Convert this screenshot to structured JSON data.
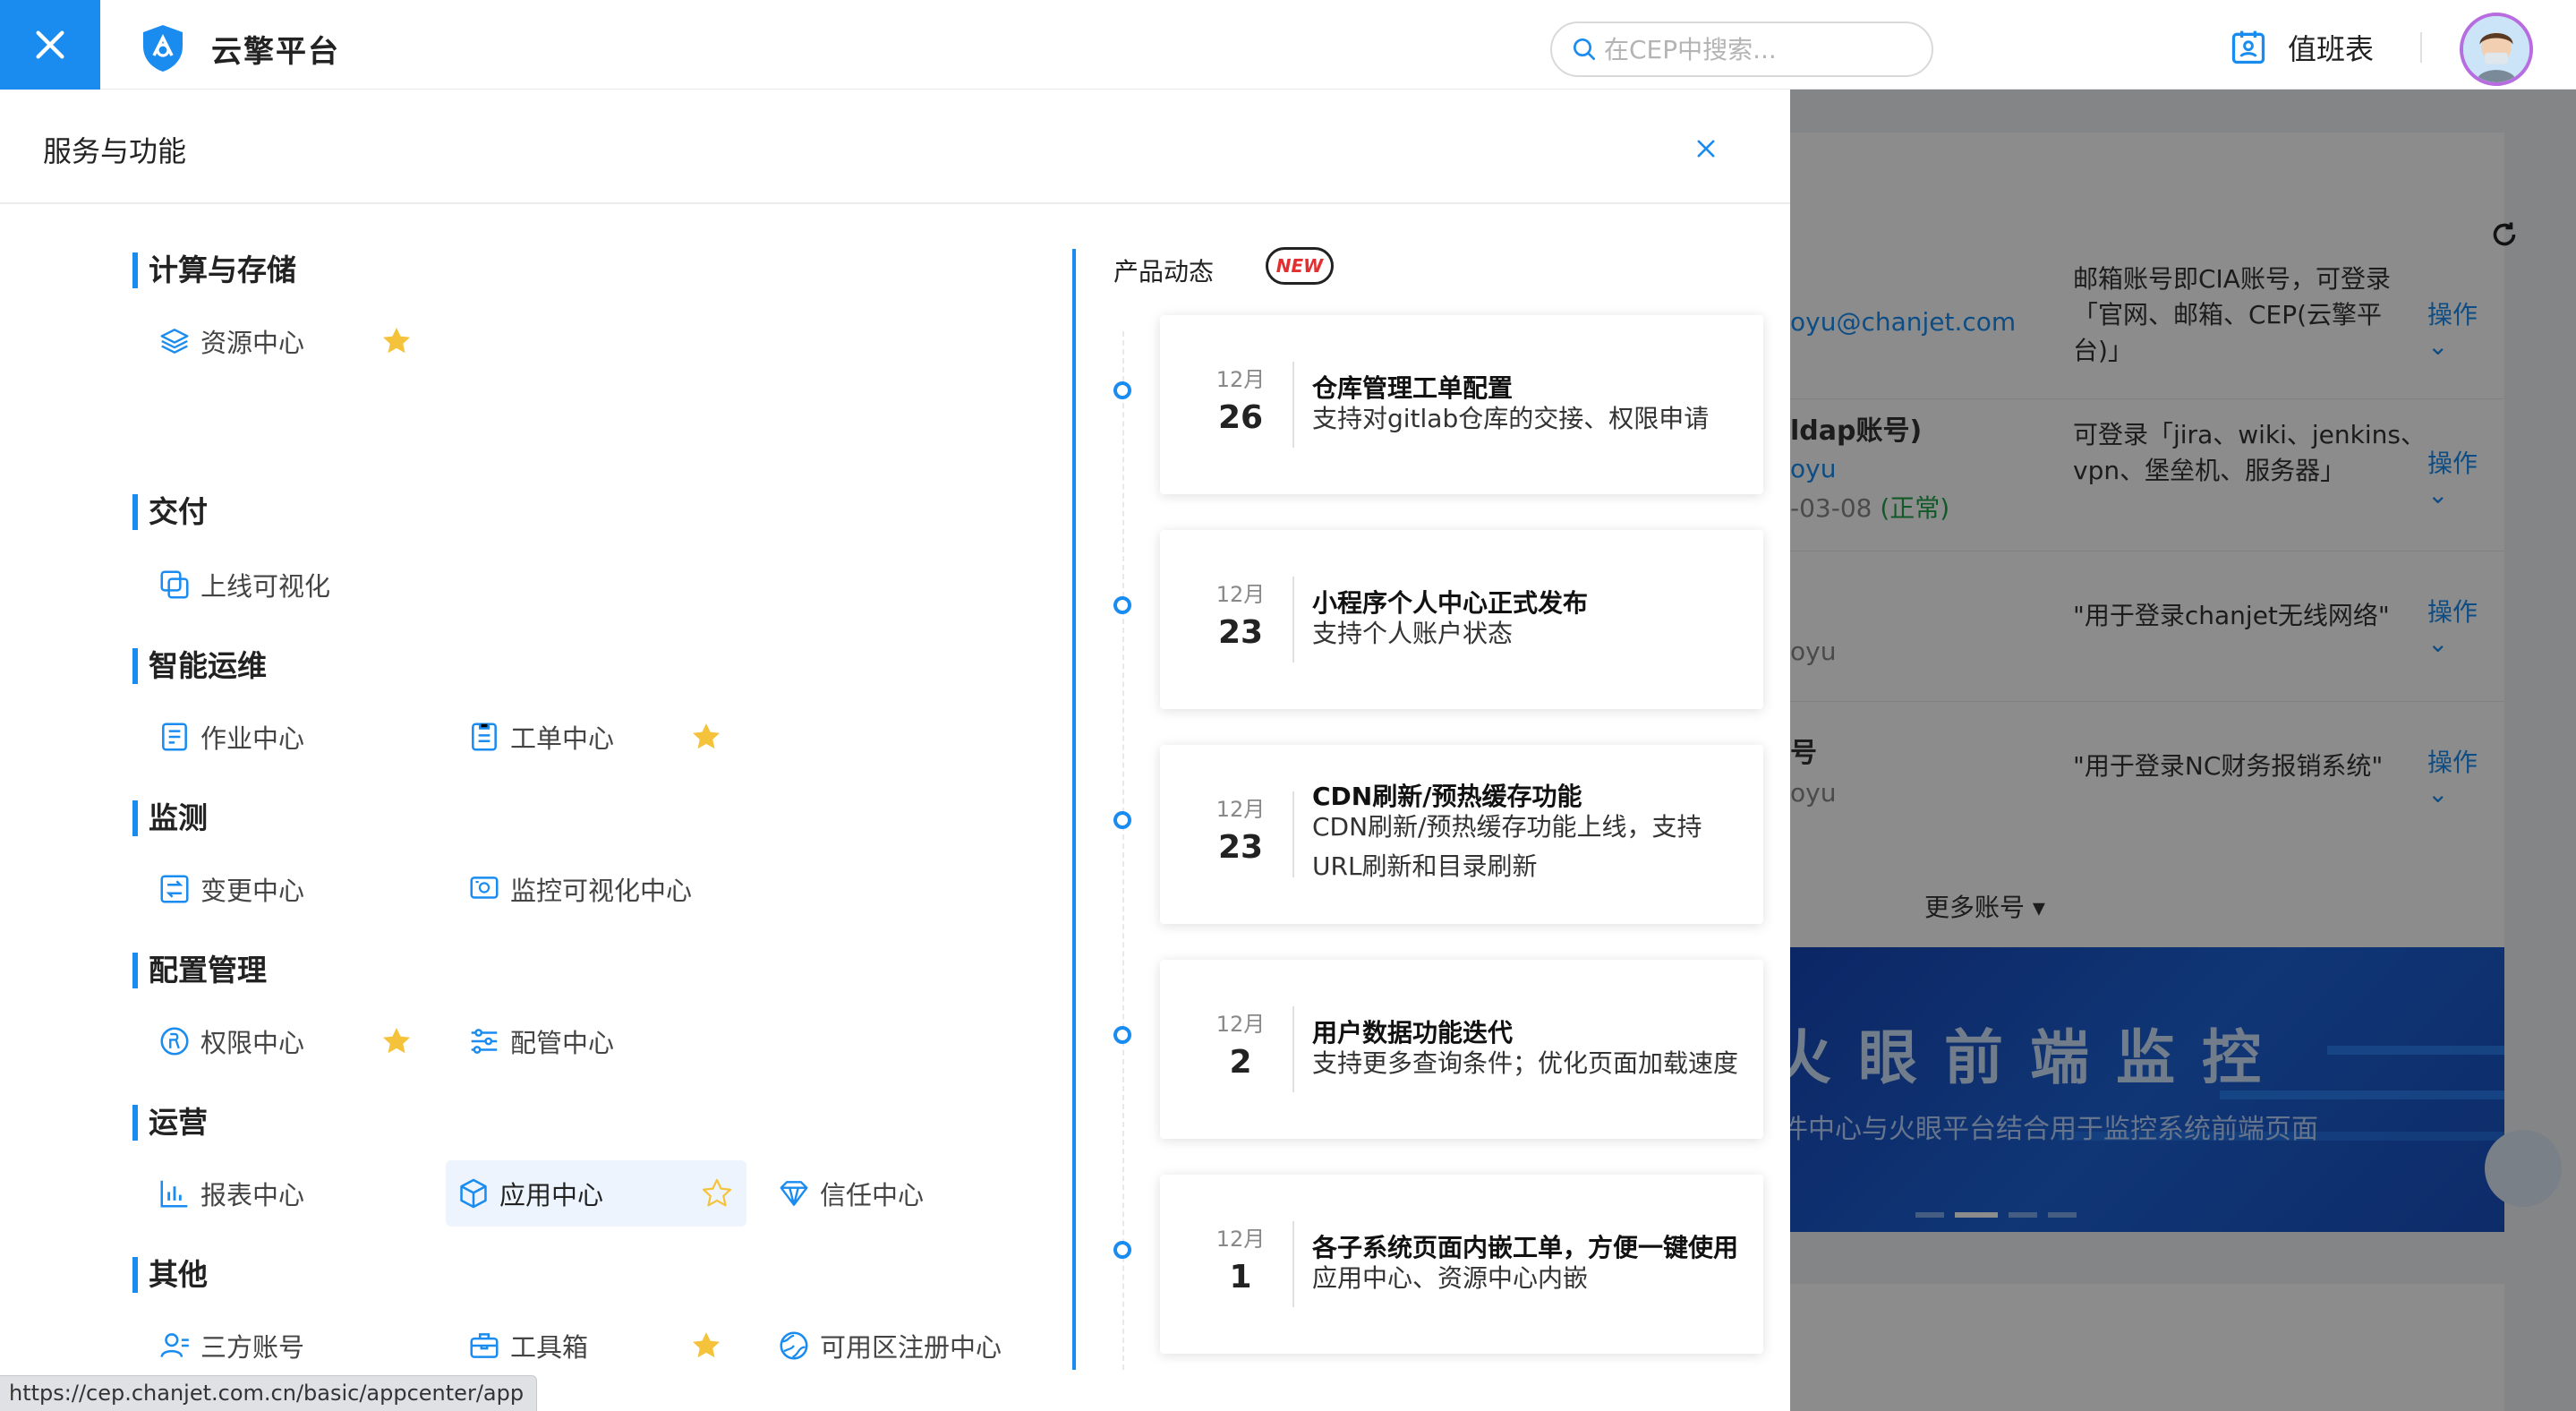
{
  "app": {
    "title": "云擎平台"
  },
  "header": {
    "search_placeholder": "在CEP中搜索...",
    "duty_label": "值班表"
  },
  "panel": {
    "title": "服务与功能",
    "categories": [
      {
        "name": "计算与存储",
        "items": [
          {
            "label": "资源中心",
            "icon": "layers-icon",
            "starred": true
          }
        ]
      },
      {
        "name": "交付",
        "items": [
          {
            "label": "上线可视化",
            "icon": "copy-squares-icon",
            "starred": false
          }
        ]
      },
      {
        "name": "智能运维",
        "items": [
          {
            "label": "作业中心",
            "icon": "document-icon",
            "starred": false
          },
          {
            "label": "工单中心",
            "icon": "clipboard-icon",
            "starred": true
          }
        ]
      },
      {
        "name": "监测",
        "items": [
          {
            "label": "变更中心",
            "icon": "swap-document-icon",
            "starred": false
          },
          {
            "label": "监控可视化中心",
            "icon": "monitor-screen-icon",
            "starred": false
          }
        ]
      },
      {
        "name": "配置管理",
        "items": [
          {
            "label": "权限中心",
            "icon": "permission-icon",
            "starred": true
          },
          {
            "label": "配管中心",
            "icon": "sliders-icon",
            "starred": false
          }
        ]
      },
      {
        "name": "运营",
        "items": [
          {
            "label": "报表中心",
            "icon": "bar-chart-icon",
            "starred": false
          },
          {
            "label": "应用中心",
            "icon": "cube-icon",
            "starred": false
          },
          {
            "label": "信任中心",
            "icon": "diamond-icon",
            "starred": false
          }
        ]
      },
      {
        "name": "其他",
        "items": [
          {
            "label": "三方账号",
            "icon": "user-icon",
            "starred": false
          },
          {
            "label": "工具箱",
            "icon": "toolbox-icon",
            "starred": true
          },
          {
            "label": "可用区注册中心",
            "icon": "globe-icon",
            "starred": false
          }
        ]
      }
    ]
  },
  "news": {
    "title": "产品动态",
    "badge": "NEW",
    "items": [
      {
        "month": "12月",
        "day": "26",
        "title": "仓库管理工单配置",
        "desc": "支持对gitlab仓库的交接、权限申请"
      },
      {
        "month": "12月",
        "day": "23",
        "title": "小程序个人中心正式发布",
        "desc": "支持个人账户状态"
      },
      {
        "month": "12月",
        "day": "23",
        "title": "CDN刷新/预热缓存功能",
        "desc": "CDN刷新/预热缓存功能上线，支持URL刷新和目录刷新"
      },
      {
        "month": "12月",
        "day": "2",
        "title": "用户数据功能迭代",
        "desc": "支持更多查询条件；优化页面加载速度"
      },
      {
        "month": "12月",
        "day": "1",
        "title": "各子系统页面内嵌工单，方便一键使用",
        "desc": "应用中心、资源中心内嵌"
      }
    ]
  },
  "background": {
    "rows": [
      {
        "left": "oyu@chanjet.com",
        "desc": "邮箱账号即CIA账号，可登录「官网、邮箱、CEP(云擎平台)」",
        "action": "操作"
      },
      {
        "left_title": "ldap账号)",
        "left_sub": "oyu",
        "left_date": "-03-08",
        "left_status": "(正常)",
        "desc": "可登录「jira、wiki、jenkins、vpn、堡垒机、服务器」",
        "action": "操作"
      },
      {
        "left_sub": "oyu",
        "desc": "\"用于登录chanjet无线网络\"",
        "action": "操作"
      },
      {
        "left_title": "号",
        "left_sub": "oyu",
        "desc": "\"用于登录NC财务报销系统\"",
        "action": "操作"
      }
    ],
    "more_label": "更多账号",
    "banner_title": "火眼前端监控",
    "banner_subtitle": "件中心与火眼平台结合用于监控系统前端页面"
  },
  "status_bar": {
    "url": "https://cep.chanjet.com.cn/basic/appcenter/app"
  },
  "colors": {
    "accent": "#1a8cf0",
    "star": "#f5c33b",
    "badge_text": "#e23030"
  }
}
